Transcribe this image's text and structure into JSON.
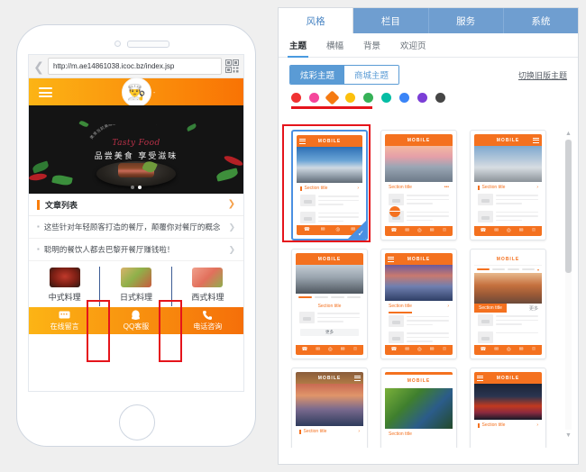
{
  "phone_preview": {
    "browser": {
      "back_icon": "chevron-left-icon",
      "url": "http://m.ae14861038.icoc.bz/index.jsp",
      "url_placeholder": "http://",
      "qr_icon": "qr-code-icon"
    },
    "site_header": {
      "menu_icon": "hamburger-menu-icon",
      "logo_glyph": "👨‍🍳",
      "title": "-"
    },
    "banner": {
      "arc_text": "美食当前美味出众人间美味 品尝美食",
      "script_text": "Tasty Food",
      "slogan": "品尝美食 享受滋味",
      "dots": 2,
      "active_dot": 2
    },
    "article_section": {
      "title": "文章列表",
      "chevron_icon": "chevron-right-icon",
      "items": [
        "这些针对年轻顾客打造的餐厅，颠覆你对餐厅的概念",
        "聪明的餐饮人都去巴黎开餐厅赚钱啦！"
      ]
    },
    "categories": [
      {
        "label": "中式料理",
        "thumb_icon": "chinese-dish-icon"
      },
      {
        "label": "日式料理",
        "thumb_icon": "japanese-dish-icon"
      },
      {
        "label": "西式料理",
        "thumb_icon": "western-dish-icon"
      }
    ],
    "service_bar": [
      {
        "label": "在线留言",
        "icon": "message-icon"
      },
      {
        "label": "QQ客服",
        "icon": "qq-penguin-icon"
      },
      {
        "label": "电话咨询",
        "icon": "phone-icon"
      }
    ],
    "home_button_icon": "home-button-icon"
  },
  "panel": {
    "main_tabs": [
      {
        "label": "风格",
        "active": true
      },
      {
        "label": "栏目",
        "active": false
      },
      {
        "label": "服务",
        "active": false
      },
      {
        "label": "系统",
        "active": false
      }
    ],
    "sub_tabs": [
      {
        "label": "主题",
        "active": true
      },
      {
        "label": "横幅",
        "active": false
      },
      {
        "label": "背景",
        "active": false
      },
      {
        "label": "欢迎页",
        "active": false
      }
    ],
    "segmented": [
      {
        "label": "炫彩主题",
        "active": true
      },
      {
        "label": "商城主题",
        "active": false
      }
    ],
    "legacy_link": "切换旧版主题",
    "colors": [
      {
        "name": "red",
        "hex": "#f03232",
        "selected": false
      },
      {
        "name": "pink",
        "hex": "#f5469b",
        "selected": false
      },
      {
        "name": "orange",
        "hex": "#f57a12",
        "selected": true
      },
      {
        "name": "yellow",
        "hex": "#fcc00d",
        "selected": false
      },
      {
        "name": "green",
        "hex": "#36b157",
        "selected": false
      },
      {
        "name": "teal",
        "hex": "#05bda4",
        "selected": false
      },
      {
        "name": "blue",
        "hex": "#3a84f7",
        "selected": false
      },
      {
        "name": "purple",
        "hex": "#7b3ed6",
        "selected": false
      },
      {
        "name": "gray",
        "hex": "#464646",
        "selected": false
      }
    ],
    "scrollbar": {
      "up_icon": "chevron-up-icon",
      "down_icon": "chevron-down-icon"
    },
    "themes": [
      {
        "header_title": "MOBILE",
        "section_title": "Section title",
        "selected": true,
        "photo": "snow-mountain",
        "layout": "list",
        "more_label": "",
        "check_icon": "check-icon"
      },
      {
        "header_title": "MOBILE",
        "section_title": "Section title",
        "selected": false,
        "photo": "pink-beach",
        "layout": "fab",
        "more_label": "•••"
      },
      {
        "header_title": "MOBILE",
        "section_title": "Section title",
        "selected": false,
        "photo": "road-sky",
        "layout": "list",
        "more_label": ""
      },
      {
        "header_title": "MOBILE",
        "section_title": "Section title",
        "selected": false,
        "photo": "grey-mountain",
        "layout": "centered",
        "more_label": "更多"
      },
      {
        "header_title": "MOBILE",
        "section_title": "Section title",
        "selected": false,
        "photo": "valley-sunset",
        "layout": "underline",
        "more_label": ""
      },
      {
        "header_title": "MOBILE",
        "section_title": "Section title",
        "selected": false,
        "photo": "desert-road",
        "layout": "tabbed",
        "more_label": "更多"
      },
      {
        "header_title": "MOBILE",
        "section_title": "Section title",
        "selected": false,
        "photo": "sunset-rock",
        "layout": "list",
        "more_label": ""
      },
      {
        "header_title": "MOBILE",
        "section_title": "Section title",
        "selected": false,
        "photo": "green-frog",
        "layout": "list",
        "more_label": ""
      },
      {
        "header_title": "MOBILE",
        "section_title": "Section title",
        "selected": false,
        "photo": "night-city",
        "layout": "list",
        "more_label": ""
      }
    ]
  },
  "annotations": {
    "color": "#e5141b",
    "boxes": [
      "category-divider-1",
      "category-divider-2",
      "selected-theme-card"
    ],
    "underline": "color-swatch-row"
  }
}
